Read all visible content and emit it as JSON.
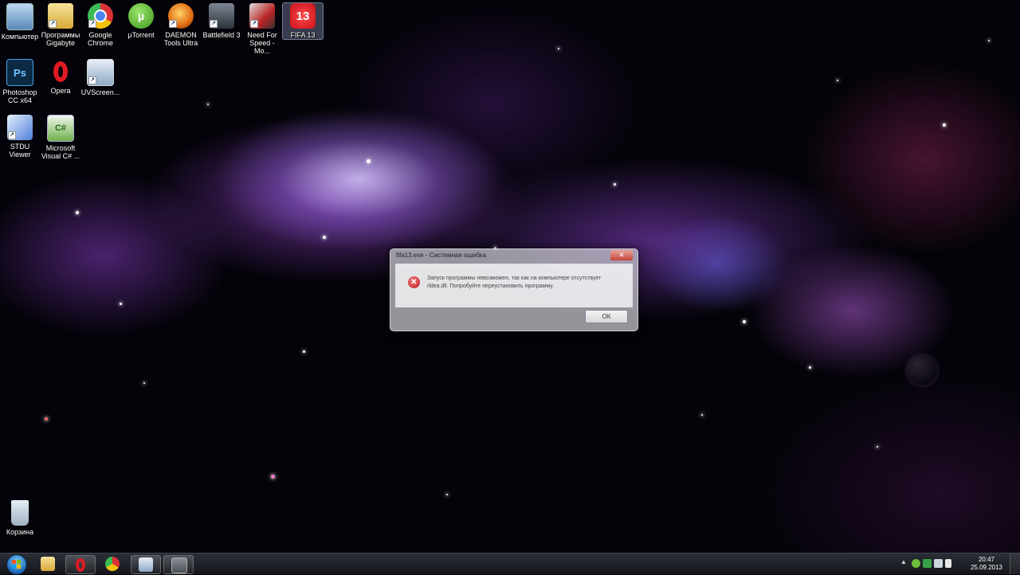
{
  "desktop": {
    "icons": [
      {
        "label": "Компьютер",
        "icon": "computer-icon"
      },
      {
        "label": "Программы Gigabyte",
        "icon": "folder-icon"
      },
      {
        "label": "Google Chrome",
        "icon": "chrome-icon"
      },
      {
        "label": "µTorrent",
        "icon": "utorrent-icon"
      },
      {
        "label": "DAEMON Tools Ultra",
        "icon": "daemon-tools-icon"
      },
      {
        "label": "Battlefield 3",
        "icon": "battlefield-icon"
      },
      {
        "label": "Need For Speed - Mo...",
        "icon": "nfs-icon"
      },
      {
        "label": "FIFA 13",
        "icon": "fifa-icon",
        "badge": "13"
      },
      {
        "label": "Photoshop CC x64",
        "icon": "photoshop-icon",
        "badge": "Ps"
      },
      {
        "label": "Opera",
        "icon": "opera-icon"
      },
      {
        "label": "UVScreen...",
        "icon": "uvscreen-icon"
      },
      {
        "label": "STDU Viewer",
        "icon": "stdu-viewer-icon"
      },
      {
        "label": "Microsoft Visual C# ...",
        "icon": "visual-csharp-icon",
        "badge": "C#"
      },
      {
        "label": "Корзина",
        "icon": "recycle-bin-icon"
      }
    ]
  },
  "dialog": {
    "title": "fifa13.exe - Системная ошибка",
    "message": "Запуск программы невозможен, так как на компьютере отсутствует rldea.dll. Попробуйте переустановить программу.",
    "ok_label": "ОК",
    "close_label": "✕"
  },
  "taskbar": {
    "clock_time": "20:47",
    "clock_date": "25.09.2013",
    "pinned": [
      "explorer-icon",
      "opera-icon",
      "chrome-icon",
      "uvscreen-icon",
      "fifa-window-icon"
    ]
  },
  "colors": {
    "taskbar": "#1c1f25",
    "error_red": "#c0161d",
    "selection": "#96aad2"
  }
}
